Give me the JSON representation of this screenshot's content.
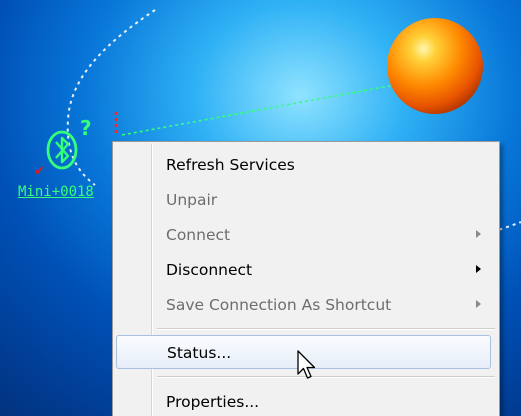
{
  "device": {
    "name": "Mini+0018",
    "status_mark": "✔",
    "unknown_mark": "?"
  },
  "context_menu": {
    "items": [
      {
        "label": "Refresh Services",
        "enabled": true,
        "submenu": false
      },
      {
        "label": "Unpair",
        "enabled": false,
        "submenu": false
      },
      {
        "label": "Connect",
        "enabled": false,
        "submenu": true
      },
      {
        "label": "Disconnect",
        "enabled": true,
        "submenu": true
      },
      {
        "label": "Save Connection As Shortcut",
        "enabled": false,
        "submenu": true
      },
      {
        "label": "Status...",
        "enabled": true,
        "submenu": false,
        "hovered": true
      },
      {
        "label": "Properties...",
        "enabled": true,
        "submenu": false
      }
    ]
  },
  "colors": {
    "background_center": "#8fe3ff",
    "background_edge": "#02327c",
    "device_icon": "#35ff7a",
    "status_check": "#e31b1b",
    "orb": "#ff7a00",
    "menu_background": "#f1f1f1",
    "hover_border": "#a9c0de"
  },
  "icons": {
    "device": "bluetooth-device-icon",
    "computer_node": "orange-orb-icon",
    "cursor": "arrow-cursor-icon"
  }
}
